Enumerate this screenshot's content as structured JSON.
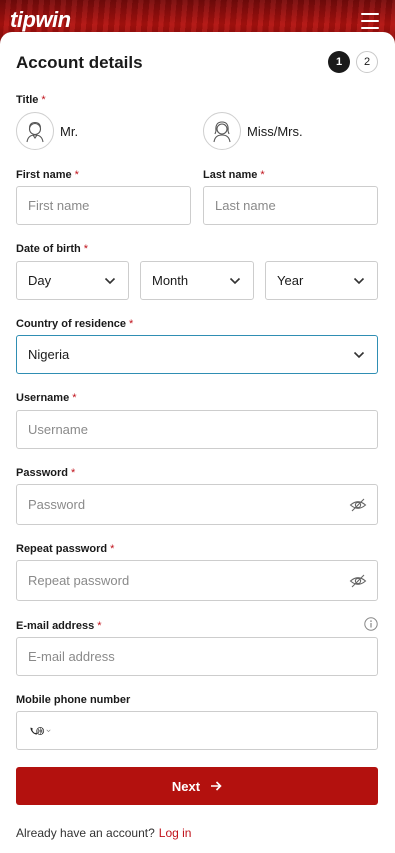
{
  "header": {
    "logo": "tipwin",
    "menu_icon": "hamburger-icon"
  },
  "form": {
    "heading": "Account details",
    "steps": [
      "1",
      "2"
    ],
    "title_label": "Title",
    "title_options": [
      {
        "label": "Mr.",
        "icon": "male-avatar-icon"
      },
      {
        "label": "Miss/Mrs.",
        "icon": "female-avatar-icon"
      }
    ],
    "first_name": {
      "label": "First name",
      "placeholder": "First name"
    },
    "last_name": {
      "label": "Last name",
      "placeholder": "Last name"
    },
    "dob": {
      "label": "Date of birth",
      "day": "Day",
      "month": "Month",
      "year": "Year"
    },
    "country": {
      "label": "Country of residence",
      "value": "Nigeria"
    },
    "username": {
      "label": "Username",
      "placeholder": "Username"
    },
    "password": {
      "label": "Password",
      "placeholder": "Password"
    },
    "repeat_password": {
      "label": "Repeat password",
      "placeholder": "Repeat password"
    },
    "email": {
      "label": "E-mail address",
      "placeholder": "E-mail address"
    },
    "phone": {
      "label": "Mobile phone number"
    },
    "required_mark": "*",
    "next_label": "Next",
    "footer_text": "Already have an account?",
    "login_link": "Log in"
  },
  "colors": {
    "brand_red": "#b3110e",
    "required_red": "#c0121b",
    "focus_border": "#2f8eb3"
  }
}
